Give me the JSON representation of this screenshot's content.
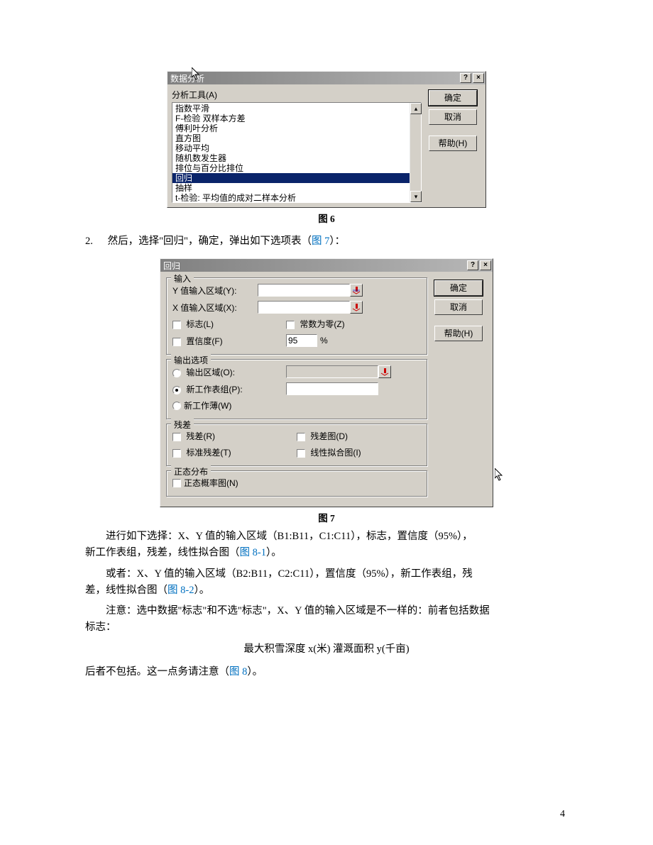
{
  "dialog6": {
    "title": "数据分析",
    "tools_label": "分析工具(A)",
    "items": [
      "指数平滑",
      "F-检验 双样本方差",
      "傅利叶分析",
      "直方图",
      "移动平均",
      "随机数发生器",
      "排位与百分比排位",
      "回归",
      "抽样",
      "t-检验: 平均值的成对二样本分析"
    ],
    "selected_index": 7,
    "ok": "确定",
    "cancel": "取消",
    "help": "帮助(H)"
  },
  "caption6": "图 6",
  "step2": {
    "num": "2.",
    "lead": "然后，选择\"回归\"，确定，弹出如下选项表（",
    "link": "图 7",
    "tail": "）："
  },
  "dialog7": {
    "title": "回归",
    "ok": "确定",
    "cancel": "取消",
    "help": "帮助(H)",
    "group_input": "输入",
    "y_label": "Y 值输入区域(Y):",
    "x_label": "X 值输入区域(X):",
    "chk_labels": "标志(L)",
    "chk_constzero": "常数为零(Z)",
    "chk_confidence": "置信度(F)",
    "confidence_value": "95",
    "confidence_pct": "%",
    "group_output": "输出选项",
    "rad_outrange": "输出区域(O):",
    "rad_newsheet": "新工作表组(P):",
    "rad_newbook": "新工作薄(W)",
    "group_resid": "残差",
    "chk_resid": "残差(R)",
    "chk_residplot": "残差图(D)",
    "chk_stdresid": "标准残差(T)",
    "chk_linefit": "线性拟合图(I)",
    "group_normal": "正态分布",
    "chk_normprob": "正态概率图(N)"
  },
  "caption7": "图 7",
  "body": {
    "p1a": "进行如下选择：X、Y 值的输入区域（B1:B11，C1:C11），标志，置信度（95%），",
    "p1b": "新工作表组，残差，线性拟合图（",
    "p1link": "图 8-1",
    "p1c": "）。",
    "p2a": "或者：X、Y 值的输入区域（B2:B11，C2:C11），置信度（95%），新工作表组，残",
    "p2b": "差，线性拟合图（",
    "p2link": "图 8-2",
    "p2c": "）。",
    "p3a": "注意：选中数据\"标志\"和不选\"标志\"，X、Y 值的输入区域是不一样的：前者包括数据",
    "p3b": "标志：",
    "center_line": "最大积雪深度 x(米)  灌溉面积 y(千亩)",
    "p4a": "后者不包括。这一点务请注意（",
    "p4link": "图 8",
    "p4b": "）。"
  },
  "page_number": "4"
}
